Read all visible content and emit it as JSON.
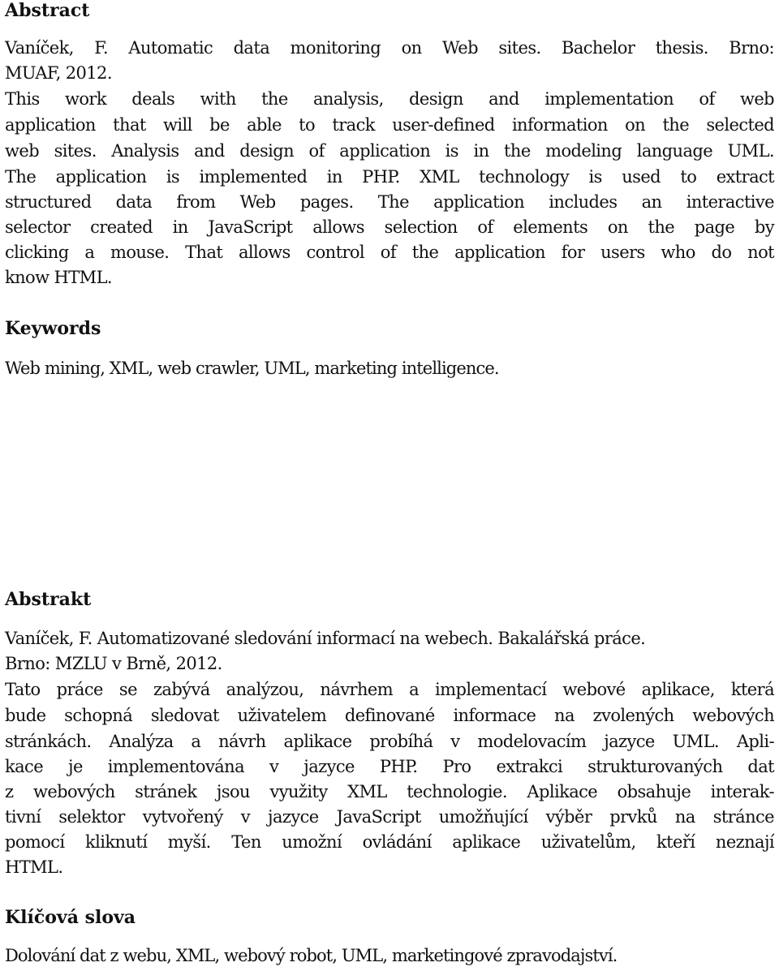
{
  "abstract_en": {
    "heading": "Abstract",
    "lines": [
      "Vaníček, F. Automatic data monitoring on Web sites. Bachelor thesis. Brno:",
      "MUAF, 2012.",
      "This work deals with the analysis, design and implementation of web",
      "application that will be able to track user-defined information on the selected",
      "web sites. Analysis and design of application is in the modeling language UML.",
      "The application is implemented in PHP. XML technology is used to extract",
      "structured data from Web pages. The application includes an interactive",
      "selector created in JavaScript allows selection of elements on the page by",
      "clicking a mouse. That allows control of the application for users who do not",
      "know HTML."
    ]
  },
  "keywords_en": {
    "heading": "Keywords",
    "text": "Web mining, XML, web crawler, UML, marketing intelligence."
  },
  "abstract_cz": {
    "heading": "Abstrakt",
    "lines": [
      "Vaníček, F. Automatizované sledování informací na webech. Bakalářská práce.",
      "Brno: MZLU v Brně, 2012.",
      "Tato práce se zabývá analýzou, návrhem a implementací webové aplikace, která",
      "bude schopná sledovat uživatelem definované informace na zvolených webových",
      "stránkách. Analýza a návrh aplikace probíhá v modelovacím jazyce UML. Apli-",
      "kace je implementována v jazyce PHP. Pro extrakci strukturovaných dat",
      "z webových stránek jsou využity XML technologie. Aplikace obsahuje interak-",
      "tivní selektor vytvořený v jazyce JavaScript umožňující výběr prvků na stránce",
      "pomocí kliknutí myší. Ten umožní ovládání aplikace uživatelům, kteří neznají",
      "HTML."
    ]
  },
  "keywords_cz": {
    "heading": "Klíčová slova",
    "text": "Dolování dat z webu, XML, webový robot, UML, marketingové zpravodajství."
  }
}
